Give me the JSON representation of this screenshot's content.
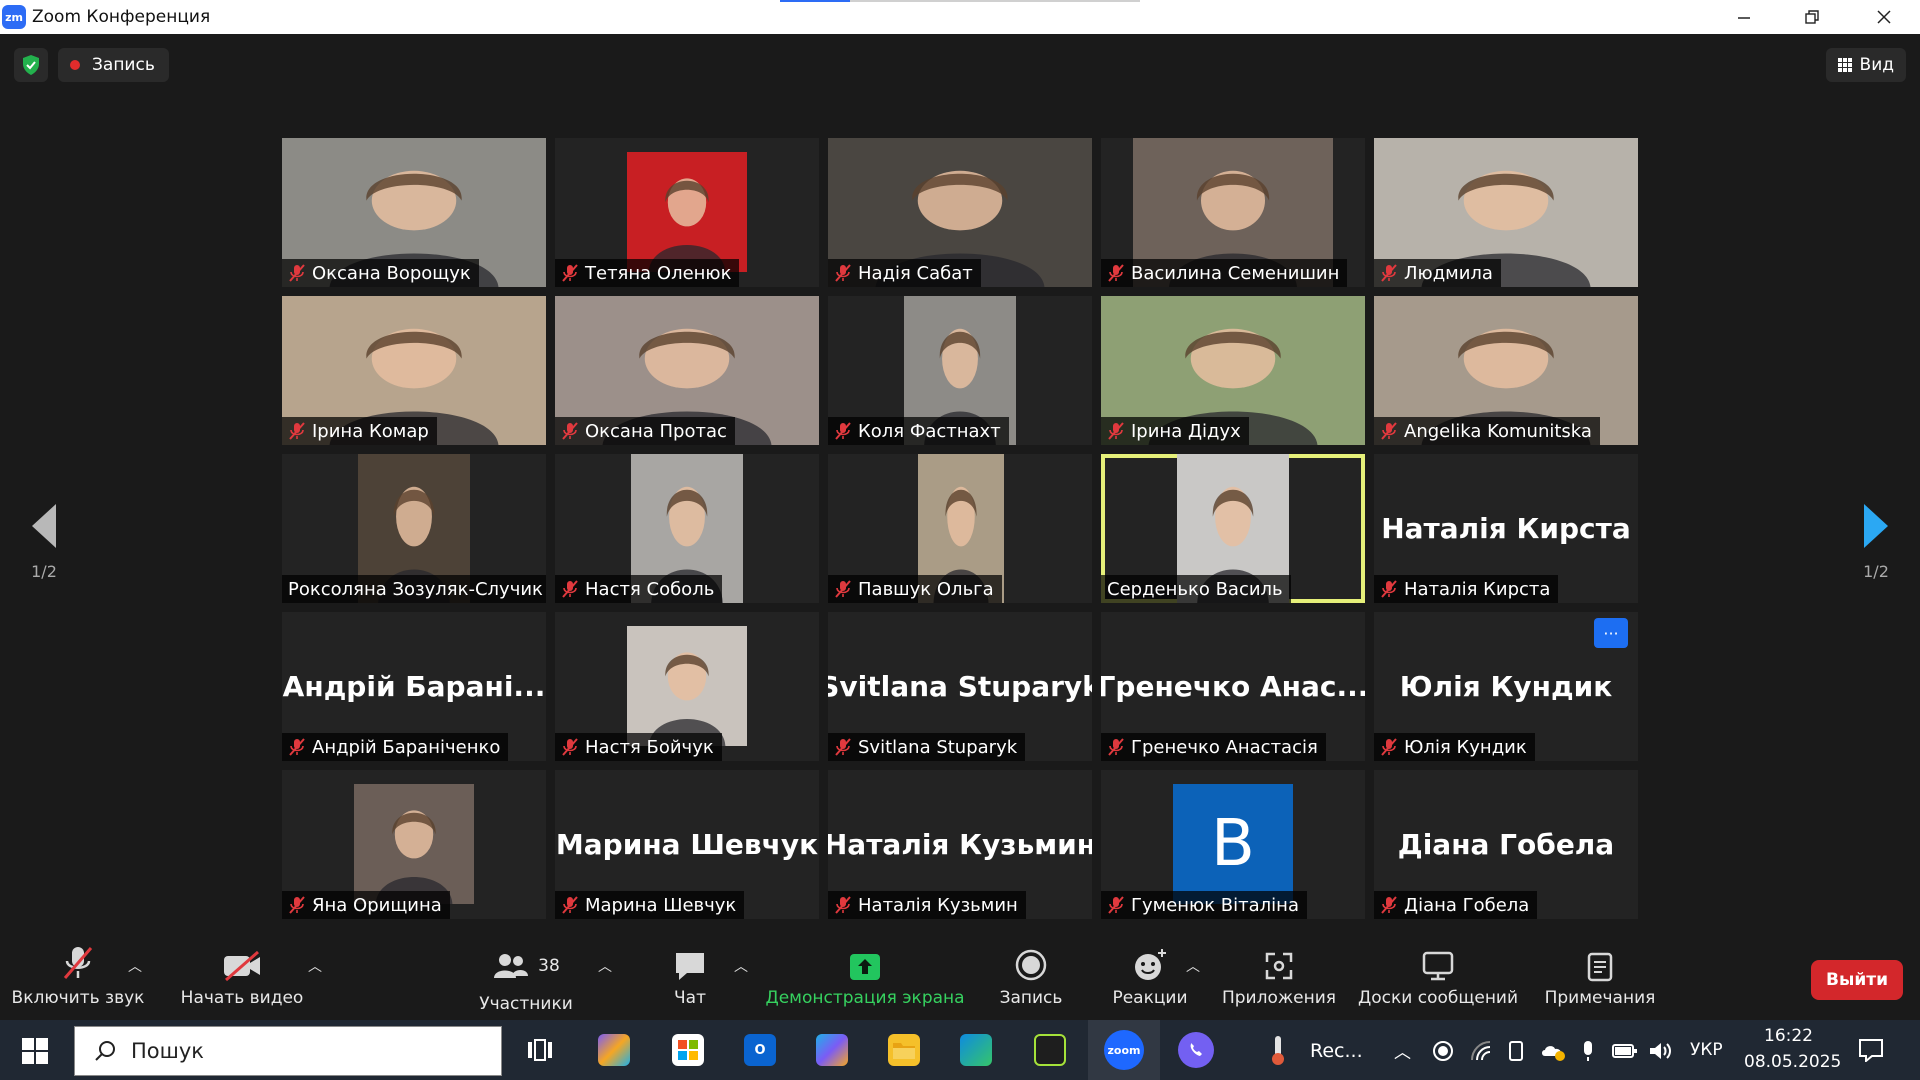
{
  "window": {
    "title": "Zoom Конференция",
    "app_icon_text": "zm"
  },
  "topbar": {
    "record_label": "Запись",
    "view_label": "Вид"
  },
  "pager": {
    "left": "1/2",
    "right": "1/2"
  },
  "participants": [
    {
      "name": "Оксана Ворощук",
      "muted": true,
      "type": "video",
      "bg": "#8c8b86"
    },
    {
      "name": "Тетяна Оленюк",
      "muted": true,
      "type": "video",
      "bg": "#c81f23"
    },
    {
      "name": "Надія Сабат",
      "muted": true,
      "type": "video",
      "bg": "#4a4641"
    },
    {
      "name": "Василина Семенишин",
      "muted": true,
      "type": "video",
      "bg": "#6e625a"
    },
    {
      "name": "Людмила",
      "muted": true,
      "type": "video",
      "bg": "#b7b2aa"
    },
    {
      "name": "Ірина Комар",
      "muted": true,
      "type": "video",
      "bg": "#b7a48d"
    },
    {
      "name": "Оксана Протас",
      "muted": true,
      "type": "video",
      "bg": "#9c908a"
    },
    {
      "name": "Коля Фастнахт",
      "muted": true,
      "type": "video",
      "bg": "#8d8b87"
    },
    {
      "name": "Ірина Дідух",
      "muted": true,
      "type": "video",
      "bg": "#8ea074"
    },
    {
      "name": "Angelika Komunitska",
      "muted": true,
      "type": "video",
      "bg": "#a69a8c"
    },
    {
      "name": "Роксоляна Зозуляк-Случик",
      "muted": false,
      "type": "video",
      "bg": "#4d4237"
    },
    {
      "name": "Настя Соболь",
      "muted": true,
      "type": "video",
      "bg": "#a8a6a3"
    },
    {
      "name": "Павшук Ольга",
      "muted": true,
      "type": "video",
      "bg": "#aa9c86"
    },
    {
      "name": "Серденько Василь",
      "muted": false,
      "type": "video",
      "bg": "#c9c8c6",
      "active": true
    },
    {
      "name": "Наталія Кирста",
      "muted": true,
      "type": "name",
      "bigname": "Наталія Кирста"
    },
    {
      "name": "Андрій Бараніченко",
      "muted": true,
      "type": "name",
      "bigname": "Андрій  Барані..."
    },
    {
      "name": "Настя Бойчук",
      "muted": true,
      "type": "video",
      "bg": "#c9c3bd"
    },
    {
      "name": "Svitlana Stuparyk",
      "muted": true,
      "type": "name",
      "bigname": "Svitlana Stuparyk"
    },
    {
      "name": "Гренечко Анастасія",
      "muted": true,
      "type": "name",
      "bigname": "Гренечко  Анас..."
    },
    {
      "name": "Юлія Кундик",
      "muted": true,
      "type": "name",
      "bigname": "Юлія Кундик",
      "more": "···"
    },
    {
      "name": "Яна Орищина",
      "muted": true,
      "type": "video",
      "bg": "#6b5e57"
    },
    {
      "name": "Марина Шевчук",
      "muted": true,
      "type": "name",
      "bigname": "Марина Шевчук"
    },
    {
      "name": "Наталія Кузьмин",
      "muted": true,
      "type": "name",
      "bigname": "Наталія Кузьмин"
    },
    {
      "name": "Гуменюк Віталіна",
      "muted": true,
      "type": "avatar",
      "avatar_letter": "B"
    },
    {
      "name": "Діана Гобела",
      "muted": true,
      "type": "name",
      "bigname": "Діана Гобела"
    }
  ],
  "toolbar": {
    "audio": "Включить звук",
    "video": "Начать видео",
    "participants": "Участники",
    "participants_count": "38",
    "chat": "Чат",
    "share": "Демонстрация экрана",
    "record": "Запись",
    "reactions": "Реакции",
    "apps": "Приложения",
    "whiteboards": "Доски сообщений",
    "notes": "Примечания",
    "leave": "Выйти"
  },
  "taskbar": {
    "search_label": "Пошук",
    "zoom_label": "zoom",
    "rec_label": "Rec...",
    "lang": "УКР",
    "time": "16:22",
    "date": "08.05.2025"
  },
  "colors": {
    "accent": "#2d6cf5",
    "active_speaker": "#e6f07a",
    "share_green": "#22c55e",
    "leave_red": "#d3272b",
    "muted_red": "#e0393e"
  }
}
